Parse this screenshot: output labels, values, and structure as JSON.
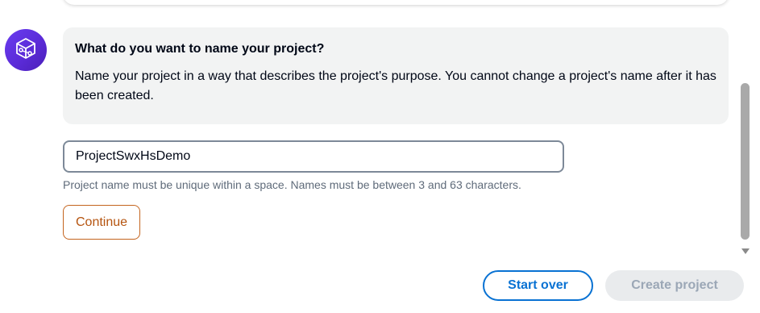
{
  "assistant": {
    "avatar_icon": "cube-network-icon",
    "avatar_color": "#5b2bd8"
  },
  "message": {
    "title": "What do you want to name your project?",
    "body": "Name your project in a way that describes the project's purpose. You cannot change a project's name after it has been created."
  },
  "project_name": {
    "value": "ProjectSwxHsDemo",
    "hint": "Project name must be unique within a space. Names must be between 3 and 63 characters."
  },
  "buttons": {
    "continue": "Continue",
    "start_over": "Start over",
    "create_project": "Create project"
  },
  "colors": {
    "continue_accent": "#b5540f",
    "primary_blue": "#0972d3",
    "disabled_text": "#9ba7b6"
  }
}
